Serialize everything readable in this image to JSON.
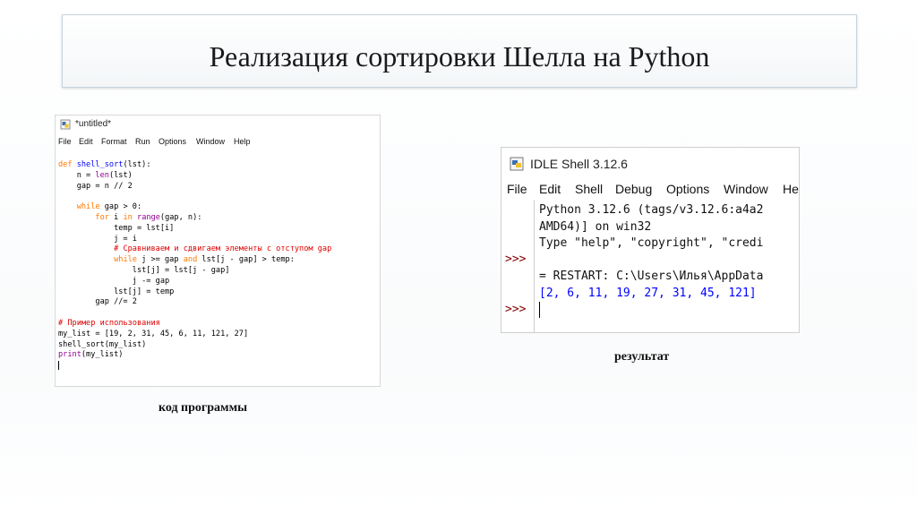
{
  "slide": {
    "title": "Реализация сортировки Шелла на Python",
    "caption_code": "код программы",
    "caption_result": "результат"
  },
  "editor": {
    "window_title": "*untitled*",
    "menu": [
      "File",
      "Edit",
      "Format",
      "Run",
      "Options",
      "Window",
      "Help"
    ],
    "code_lines": [
      [
        [
          "kw",
          "def "
        ],
        [
          "fn",
          "shell_sort"
        ],
        [
          "",
          "(lst):"
        ]
      ],
      [
        [
          "",
          "    n = "
        ],
        [
          "bi",
          "len"
        ],
        [
          "",
          "(lst)"
        ]
      ],
      [
        [
          "",
          "    gap = n // 2"
        ]
      ],
      [
        [
          "",
          ""
        ]
      ],
      [
        [
          "",
          "    "
        ],
        [
          "kw",
          "while"
        ],
        [
          "",
          " gap > 0:"
        ]
      ],
      [
        [
          "",
          "        "
        ],
        [
          "kw",
          "for"
        ],
        [
          "",
          " i "
        ],
        [
          "kw",
          "in"
        ],
        [
          "",
          " "
        ],
        [
          "bi",
          "range"
        ],
        [
          "",
          "(gap, n):"
        ]
      ],
      [
        [
          "",
          "            temp = lst[i]"
        ]
      ],
      [
        [
          "",
          "            j = i"
        ]
      ],
      [
        [
          "",
          "            "
        ],
        [
          "cm",
          "# Сравниваем и сдвигаем элементы с отступом gap"
        ]
      ],
      [
        [
          "",
          "            "
        ],
        [
          "kw",
          "while"
        ],
        [
          "",
          " j >= gap "
        ],
        [
          "kw",
          "and"
        ],
        [
          "",
          " lst[j - gap] > temp:"
        ]
      ],
      [
        [
          "",
          "                lst[j] = lst[j - gap]"
        ]
      ],
      [
        [
          "",
          "                j -= gap"
        ]
      ],
      [
        [
          "",
          "            lst[j] = temp"
        ]
      ],
      [
        [
          "",
          "        gap //= 2"
        ]
      ],
      [
        [
          "",
          ""
        ]
      ],
      [
        [
          "cm",
          "# Пример использования"
        ]
      ],
      [
        [
          "",
          "my_list = [19, 2, 31, 45, 6, 11, 121, 27]"
        ]
      ],
      [
        [
          "",
          "shell_sort(my_list)"
        ]
      ],
      [
        [
          "bi",
          "print"
        ],
        [
          "",
          "(my_list)"
        ]
      ]
    ]
  },
  "shell": {
    "window_title": "IDLE Shell 3.12.6",
    "menu": [
      "File",
      "Edit",
      "Shell",
      "Debug",
      "Options",
      "Window",
      "He"
    ],
    "prompts": [
      ">>>",
      ">>>"
    ],
    "lines": [
      "Python 3.12.6 (tags/v3.12.6:a4a2",
      "AMD64)] on win32",
      "Type \"help\", \"copyright\", \"credi",
      "",
      "= RESTART: C:\\Users\\Илья\\AppData",
      "[2, 6, 11, 19, 27, 31, 45, 121]"
    ]
  }
}
